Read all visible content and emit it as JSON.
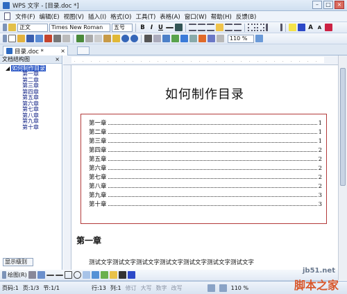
{
  "window": {
    "title": "WPS 文字 - [目录.doc *]"
  },
  "menu": [
    "文件(F)",
    "编辑(E)",
    "视图(V)",
    "插入(I)",
    "格式(O)",
    "工具(T)",
    "表格(A)",
    "窗口(W)",
    "帮助(H)",
    "反馈(B)"
  ],
  "toolbar": {
    "style_value": "正文",
    "font_value": "Times New Roman",
    "size_value": "五号",
    "bold": "B",
    "italic": "I",
    "underline": "U",
    "zoom_value": "110 %"
  },
  "tab": {
    "name": "目录.doc *",
    "close": "×"
  },
  "sidebar": {
    "title": "文档结构图",
    "close": "×",
    "root": "如何制作目录",
    "items": [
      "第一章",
      "第二章",
      "第三章",
      "第四章",
      "第五章",
      "第六章",
      "第七章",
      "第八章",
      "第九章",
      "第十章"
    ],
    "level_button": "显示级别"
  },
  "document": {
    "title": "如何制作目录",
    "toc": [
      {
        "label": "第一章",
        "page": "1"
      },
      {
        "label": "第二章",
        "page": "1"
      },
      {
        "label": "第三章",
        "page": "1"
      },
      {
        "label": "第四章",
        "page": "2"
      },
      {
        "label": "第五章",
        "page": "2"
      },
      {
        "label": "第六章",
        "page": "2"
      },
      {
        "label": "第七章",
        "page": "2"
      },
      {
        "label": "第八章",
        "page": "2"
      },
      {
        "label": "第九章",
        "page": "3"
      },
      {
        "label": "第十章",
        "page": "3"
      }
    ],
    "heading": "第一章",
    "body": "测试文字测试文字测试文字测试文字测试文字测试文字测试文字"
  },
  "drawbar": {
    "draw_label": "绘图(R)"
  },
  "status": {
    "page": "页码:1",
    "pages": "页:1/3",
    "section": "节:1/1",
    "row": "行:13",
    "col": "列:1",
    "rev": "修订",
    "caps": "大写",
    "num": "数字",
    "ovr": "改写",
    "zoom": "110 %"
  },
  "watermark": {
    "site": "jb51.net",
    "brand": "脚本之家"
  }
}
